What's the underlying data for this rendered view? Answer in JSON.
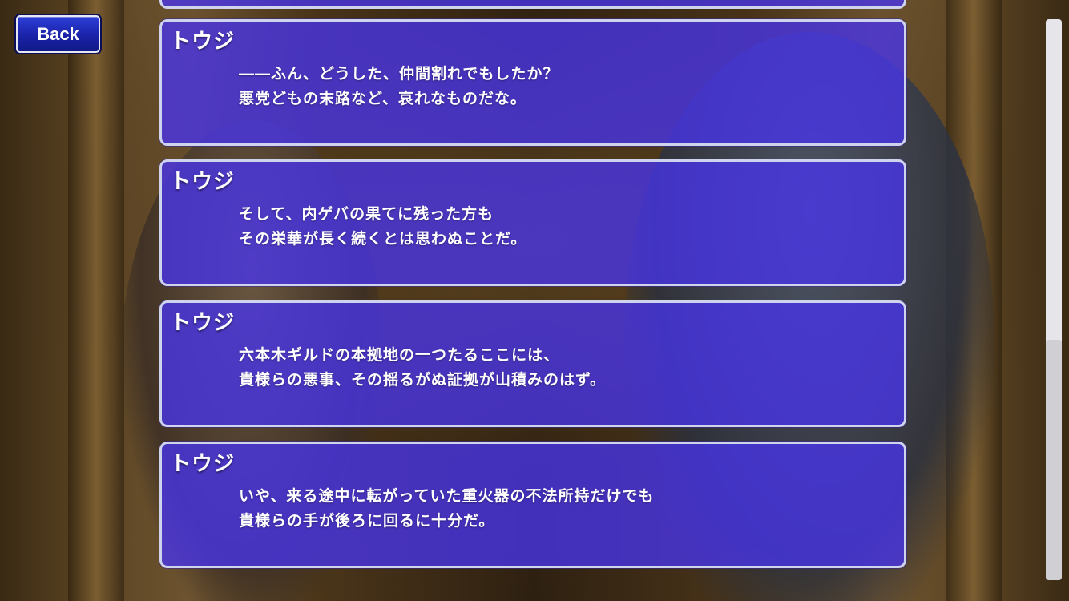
{
  "header": {
    "back_label": "Back"
  },
  "dialogue": [
    {
      "speaker": "トウジ",
      "lines": [
        "――ふん、どうした、仲間割れでもしたか？",
        "悪党どもの末路など、哀れなものだな。"
      ]
    },
    {
      "speaker": "トウジ",
      "lines": [
        "そして、内ゲバの果てに残った方も",
        "その栄華が長く続くとは思わぬことだ。"
      ]
    },
    {
      "speaker": "トウジ",
      "lines": [
        "六本木ギルドの本拠地の一つたるここには、",
        "貴様らの悪事、その揺るがぬ証拠が山積みのはず。"
      ]
    },
    {
      "speaker": "トウジ",
      "lines": [
        "いや、来る途中に転がっていた重火器の不法所持だけでも",
        "貴様らの手が後ろに回るに十分だ。"
      ]
    }
  ],
  "colors": {
    "card_fill": "#4834eb",
    "card_border": "#cfd4ee",
    "back_button": "#1a22a8",
    "scrollbar": "#e6e6ea"
  }
}
